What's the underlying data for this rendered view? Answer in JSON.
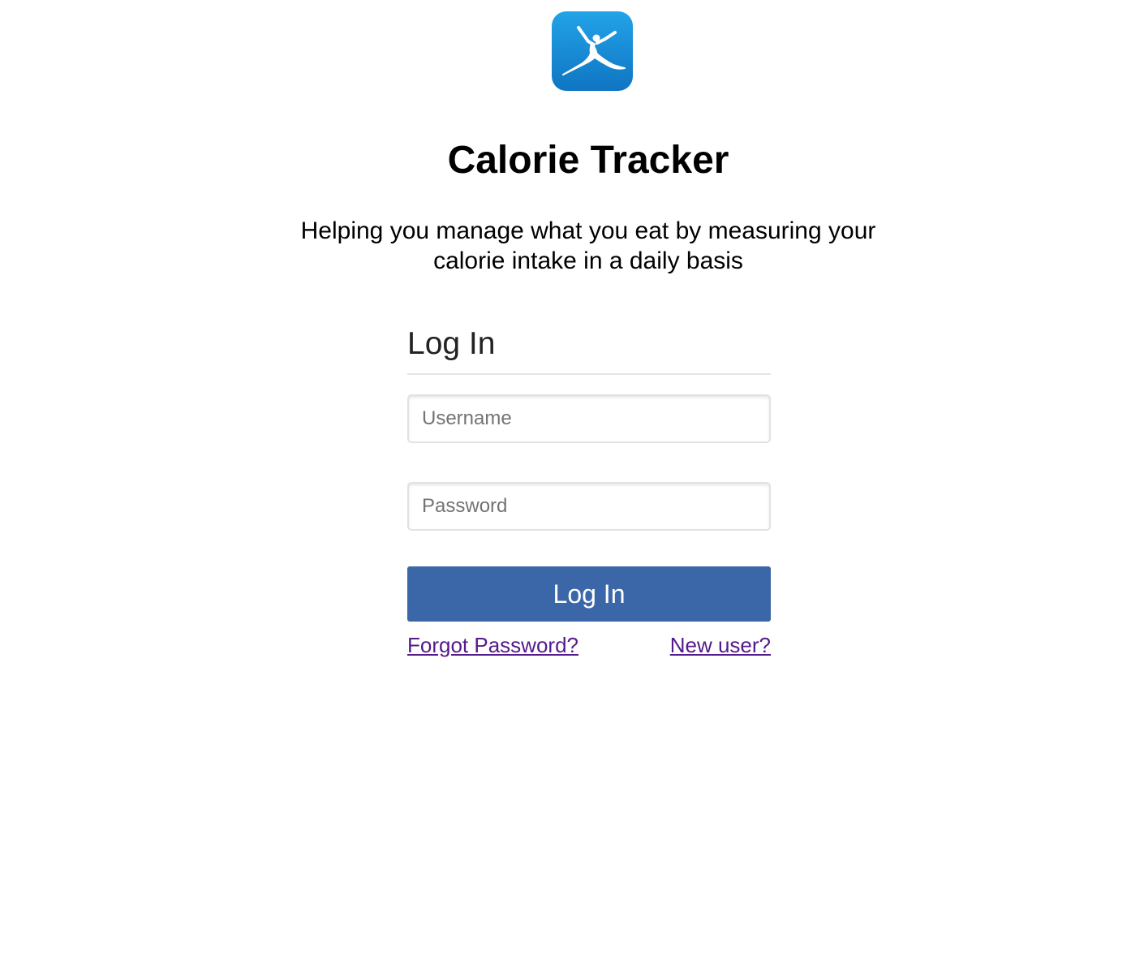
{
  "app": {
    "title": "Calorie Tracker",
    "tagline": "Helping you manage what you eat by measuring your calorie intake in a daily basis",
    "logo_icon": "jumping-figure-logo-icon"
  },
  "login_form": {
    "heading": "Log In",
    "username_placeholder": "Username",
    "password_placeholder": "Password",
    "submit_label": "Log In",
    "forgot_password_label": "Forgot Password?",
    "new_user_label": "New user?"
  },
  "colors": {
    "logo_gradient_top": "#22a3e8",
    "logo_gradient_bottom": "#0f75c2",
    "button_background": "#3b67a8",
    "link_color": "#551a8b"
  }
}
